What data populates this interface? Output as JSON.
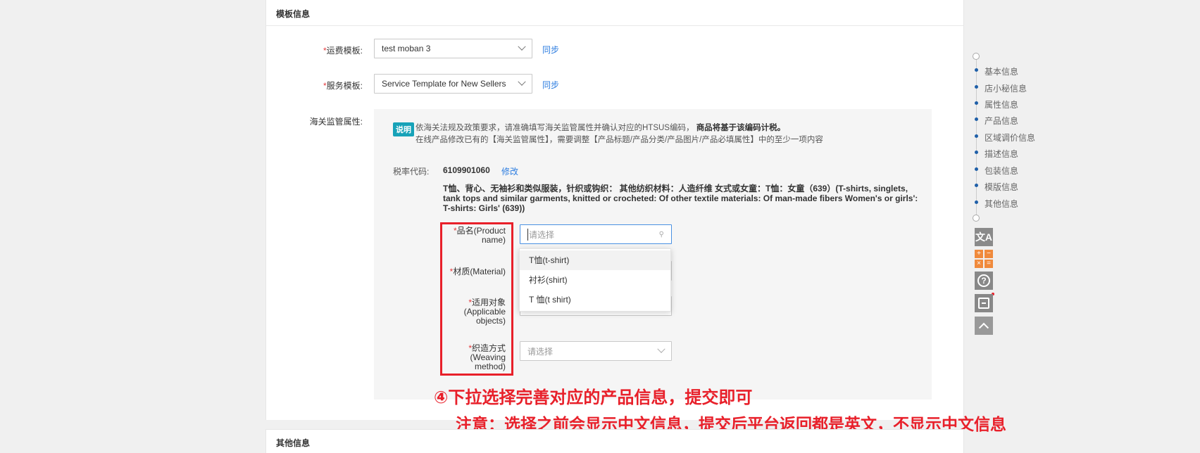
{
  "sections": {
    "template_info_title": "模板信息",
    "other_info_title": "其他信息"
  },
  "shipping": {
    "label": "运费模板:",
    "value": "test moban 3",
    "sync": "同步"
  },
  "service": {
    "label": "服务模板:",
    "value": "Service Template for New Sellers",
    "sync": "同步"
  },
  "customs": {
    "label": "海关监管属性:",
    "tag": "说明",
    "note_line1": "依海关法规及政策要求，请准确填写海关监管属性并确认对应的HTSUS编码，",
    "note_line1_bold": "商品将基于该编码计税。",
    "note_line2": "在线产品修改已有的【海关监管属性】，需要调整【产品标题/产品分类/产品图片/产品必填属性】中的至少一项内容",
    "tax_label": "税率代码:",
    "tax_code": "6109901060",
    "edit": "修改",
    "desc_line1": "T恤、背心、无袖衫和类似服装，针织或钩织：  其他纺织材料：人造纤维 女式或女童：T恤：女童（639）(T-shirts, singlets,",
    "desc_line2": "tank tops and similar garments, knitted or crocheted: Of other textile materials: Of man-made fibers Women's or girls':",
    "desc_line3": "T-shirts: Girls' (639))"
  },
  "fields": {
    "product_name_l1": "品名(Product",
    "product_name_l2": "name)",
    "product_name_placeholder": "请选择",
    "material": "材质(Material)",
    "applicable_l1": "适用对象",
    "applicable_l2": "(Applicable",
    "applicable_l3": "objects)",
    "weaving_l1": "织造方式",
    "weaving_l2": "(Weaving",
    "weaving_l3": "method)",
    "weaving_placeholder": "请选择"
  },
  "dropdown": {
    "options": [
      "T恤(t-shirt)",
      "衬衫(shirt)",
      "T 恤(t shirt)"
    ]
  },
  "annotation": {
    "line1": "④下拉选择完善对应的产品信息，提交即可",
    "line2": "注意：选择之前会显示中文信息，提交后平台返回都是英文，不显示中文信息"
  },
  "side_nav": {
    "items": [
      "基本信息",
      "店小秘信息",
      "属性信息",
      "产品信息",
      "区域调价信息",
      "描述信息",
      "包装信息",
      "模版信息",
      "其他信息"
    ]
  },
  "tools": [
    "translate-icon",
    "calculator-icon",
    "help-icon",
    "archive-icon",
    "back-to-top-icon"
  ],
  "colors": {
    "accent": "#2d7de0",
    "annotation_red": "#e8202a",
    "tag_teal": "#17a2b8",
    "nav_dot": "#1f5fa8"
  }
}
